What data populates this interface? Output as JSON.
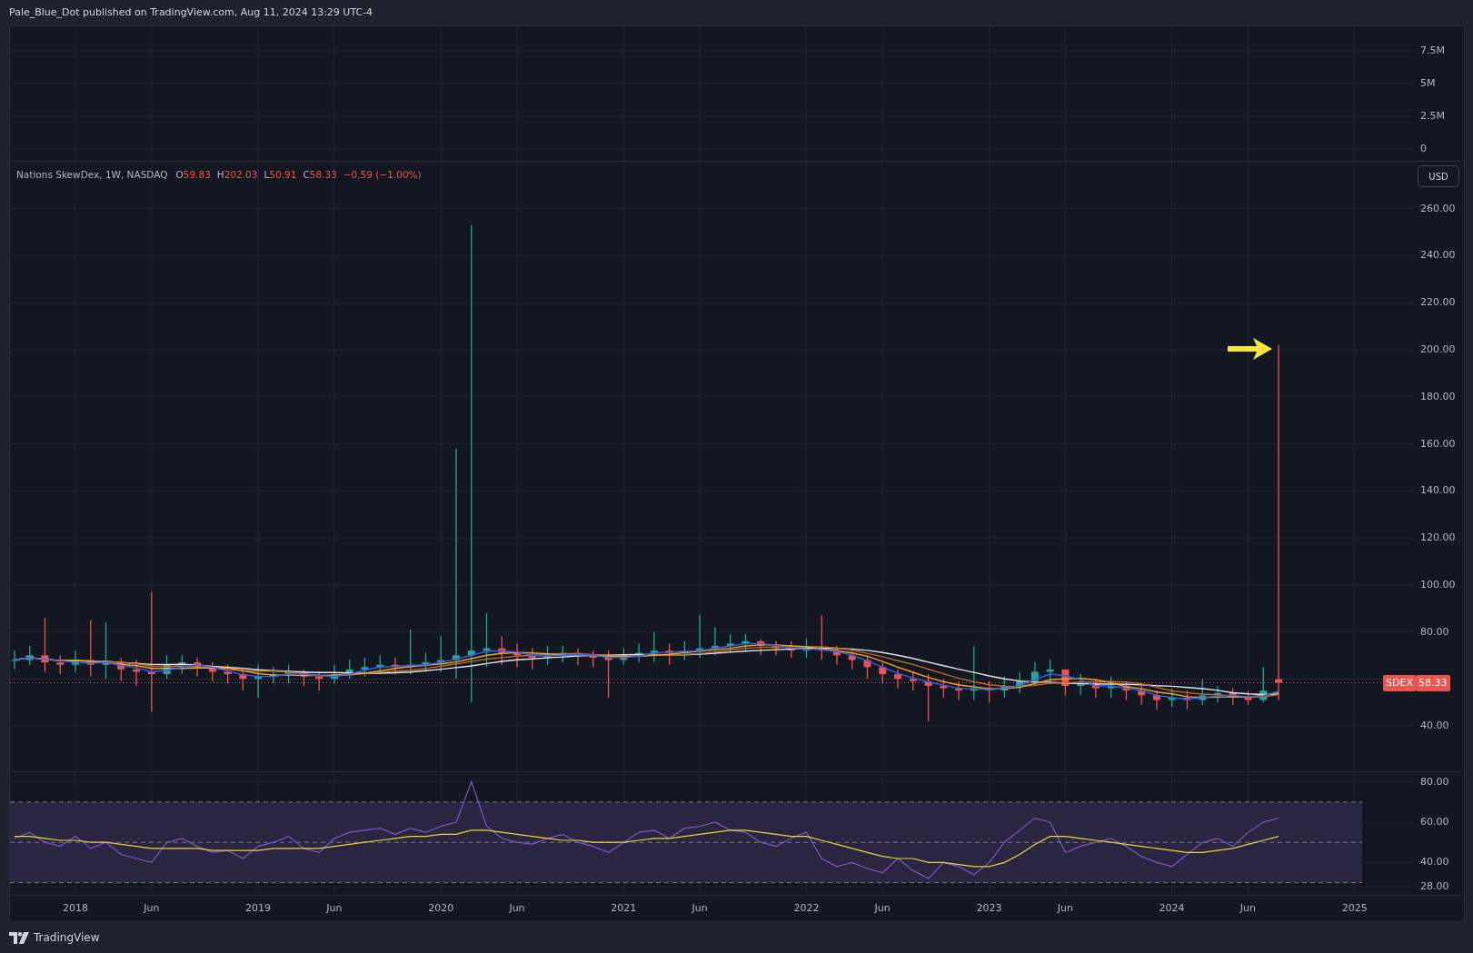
{
  "header": {
    "text": "Pale_Blue_Dot published on TradingView.com, Aug 11, 2024 13:29 UTC-4"
  },
  "volume_pane": {
    "scale_labels": [
      "7.5M",
      "5M",
      "2.5M",
      "0"
    ]
  },
  "price_pane": {
    "legend": {
      "symbol_info": "Nations SkewDex, 1W, NASDAQ",
      "ohlc": [
        {
          "label": "O",
          "value": "59.83"
        },
        {
          "label": "H",
          "value": "202.03"
        },
        {
          "label": "L",
          "value": "50.91"
        },
        {
          "label": "C",
          "value": "58.33"
        }
      ],
      "change": "−0.59 (−1.00%)"
    },
    "currency_button": "USD",
    "last_price": {
      "symbol": "SDEX",
      "price": "58.33"
    },
    "scale_labels": [
      "260.00",
      "240.00",
      "220.00",
      "200.00",
      "180.00",
      "160.00",
      "140.00",
      "120.00",
      "100.00",
      "80.00",
      "40.00"
    ]
  },
  "rsi_pane": {
    "chart_data": {
      "type": "line",
      "ylim": [
        23.5,
        84.8
      ],
      "grid": true,
      "yticks": [
        {
          "value": 80,
          "label": "80.00"
        },
        {
          "value": 60,
          "label": "60.00"
        },
        {
          "value": 40,
          "label": "40.00"
        },
        {
          "value": 28,
          "label": "28.00"
        }
      ],
      "series": [
        {
          "color": "#7e57c2",
          "values": [
            52,
            55,
            50,
            48,
            53,
            47,
            50,
            44,
            42,
            40,
            50,
            52,
            48,
            45,
            46,
            42,
            48,
            50,
            53,
            47,
            45,
            52,
            55,
            56,
            57,
            54,
            57,
            55,
            58,
            60,
            80,
            58,
            52,
            50,
            49,
            52,
            54,
            50,
            48,
            45,
            50,
            55,
            56,
            52,
            57,
            58,
            60,
            56,
            55,
            50,
            48,
            52,
            55,
            42,
            38,
            40,
            37,
            35,
            42,
            36,
            32,
            40,
            38,
            34,
            40,
            50,
            56,
            62,
            60,
            45,
            48,
            50,
            52,
            48,
            43,
            40,
            38,
            44,
            50,
            52,
            48,
            55,
            60,
            62
          ]
        },
        {
          "color": "#e6d739",
          "values": [
            53,
            53,
            52,
            51,
            51,
            50,
            50,
            49,
            48,
            47,
            47,
            47,
            47,
            46,
            46,
            46,
            46,
            47,
            47,
            47,
            47,
            48,
            49,
            50,
            51,
            52,
            53,
            53,
            54,
            54,
            56,
            56,
            55,
            54,
            53,
            52,
            51,
            51,
            50,
            50,
            50,
            51,
            52,
            52,
            53,
            54,
            55,
            56,
            56,
            55,
            54,
            53,
            53,
            51,
            49,
            47,
            45,
            43,
            42,
            42,
            40,
            40,
            39,
            38,
            38,
            40,
            44,
            49,
            53,
            53,
            52,
            51,
            50,
            49,
            48,
            47,
            46,
            45,
            45,
            46,
            47,
            49,
            51,
            53
          ]
        }
      ]
    }
  },
  "time_axis": [
    "2018",
    "Jun",
    "2019",
    "Jun",
    "2020",
    "Jun",
    "2021",
    "Jun",
    "2022",
    "Jun",
    "2023",
    "Jun",
    "2024",
    "Jun",
    "2025"
  ],
  "footer": {
    "brand": "TradingView"
  }
}
